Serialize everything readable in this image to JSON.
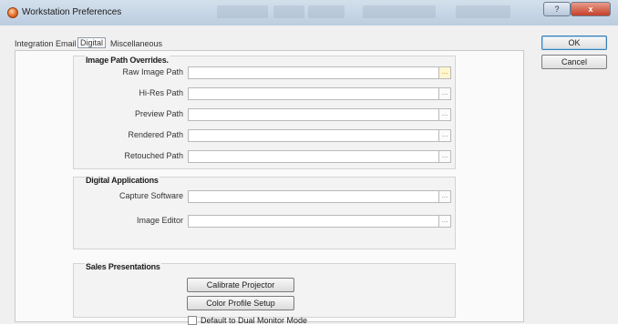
{
  "window": {
    "title": "Workstation Preferences",
    "help_label": "?",
    "close_label": "x"
  },
  "tabs": [
    {
      "label": "Integration",
      "active": false
    },
    {
      "label": "Email",
      "active": false
    },
    {
      "label": "Digital",
      "active": true
    },
    {
      "label": "Miscellaneous",
      "active": false
    }
  ],
  "image_path_overrides": {
    "title": "Image Path Overrides.",
    "rows": [
      {
        "label": "Raw Image Path",
        "value": ""
      },
      {
        "label": "Hi-Res Path",
        "value": ""
      },
      {
        "label": "Preview Path",
        "value": ""
      },
      {
        "label": "Rendered Path",
        "value": ""
      },
      {
        "label": "Retouched Path",
        "value": ""
      }
    ]
  },
  "digital_applications": {
    "title": "Digital Applications",
    "rows": [
      {
        "label": "Capture Software",
        "value": ""
      },
      {
        "label": "Image Editor",
        "value": ""
      }
    ]
  },
  "sales_presentations": {
    "title": "Sales Presentations",
    "calibrate_label": "Calibrate Projector",
    "color_profile_label": "Color Profile Setup",
    "dual_monitor_label": "Default to Dual Monitor Mode",
    "dual_monitor_checked": false
  },
  "browse_glyph": "...",
  "buttons": {
    "ok": "OK",
    "cancel": "Cancel"
  }
}
